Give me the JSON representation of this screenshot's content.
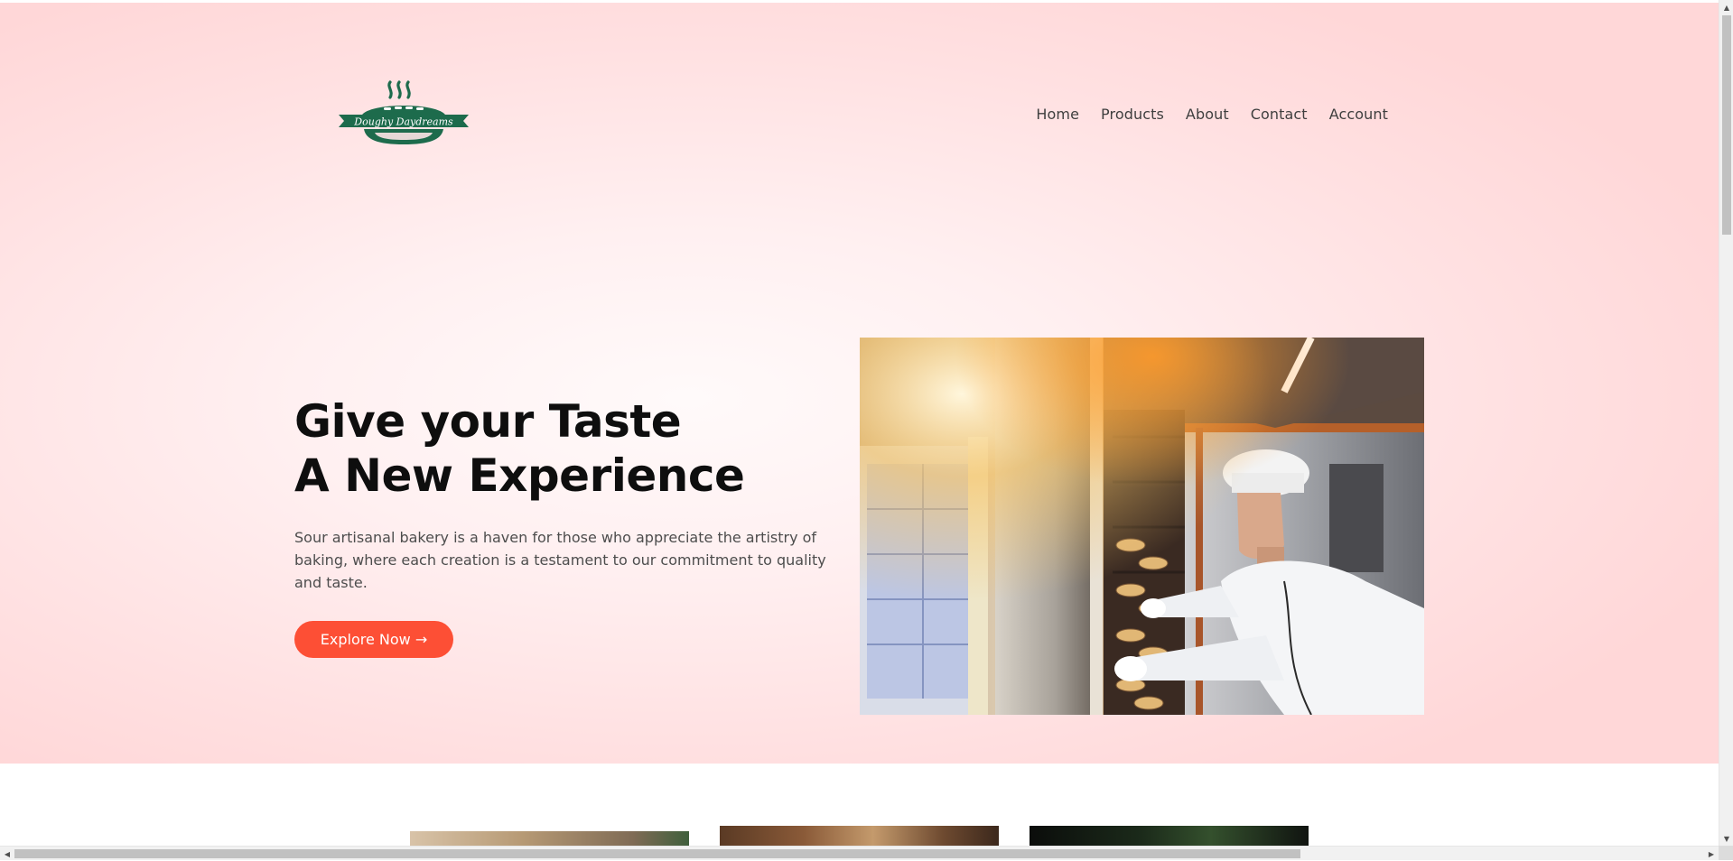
{
  "brand": {
    "name": "Doughy Daydreams",
    "color": "#1d6b4c"
  },
  "nav": {
    "items": [
      {
        "label": "Home"
      },
      {
        "label": "Products"
      },
      {
        "label": "About"
      },
      {
        "label": "Contact"
      },
      {
        "label": "Account"
      }
    ]
  },
  "hero": {
    "headline_line1": "Give your Taste",
    "headline_line2": "A New Experience",
    "description": "Sour artisanal bakery is a haven for those who appreciate the artistry of baking, where each creation is a testament to our commitment to quality and taste.",
    "cta_label": "Explore Now →",
    "cta_color": "#fd4f35",
    "image_icon": "baker-at-oven-photo"
  },
  "cards": {
    "items": [
      {
        "image_icon": "bread-photo"
      },
      {
        "image_icon": "pastry-photo"
      },
      {
        "image_icon": "greens-photo"
      }
    ]
  },
  "scrollbars": {
    "vertical": "vertical-scrollbar",
    "horizontal": "horizontal-scrollbar"
  }
}
